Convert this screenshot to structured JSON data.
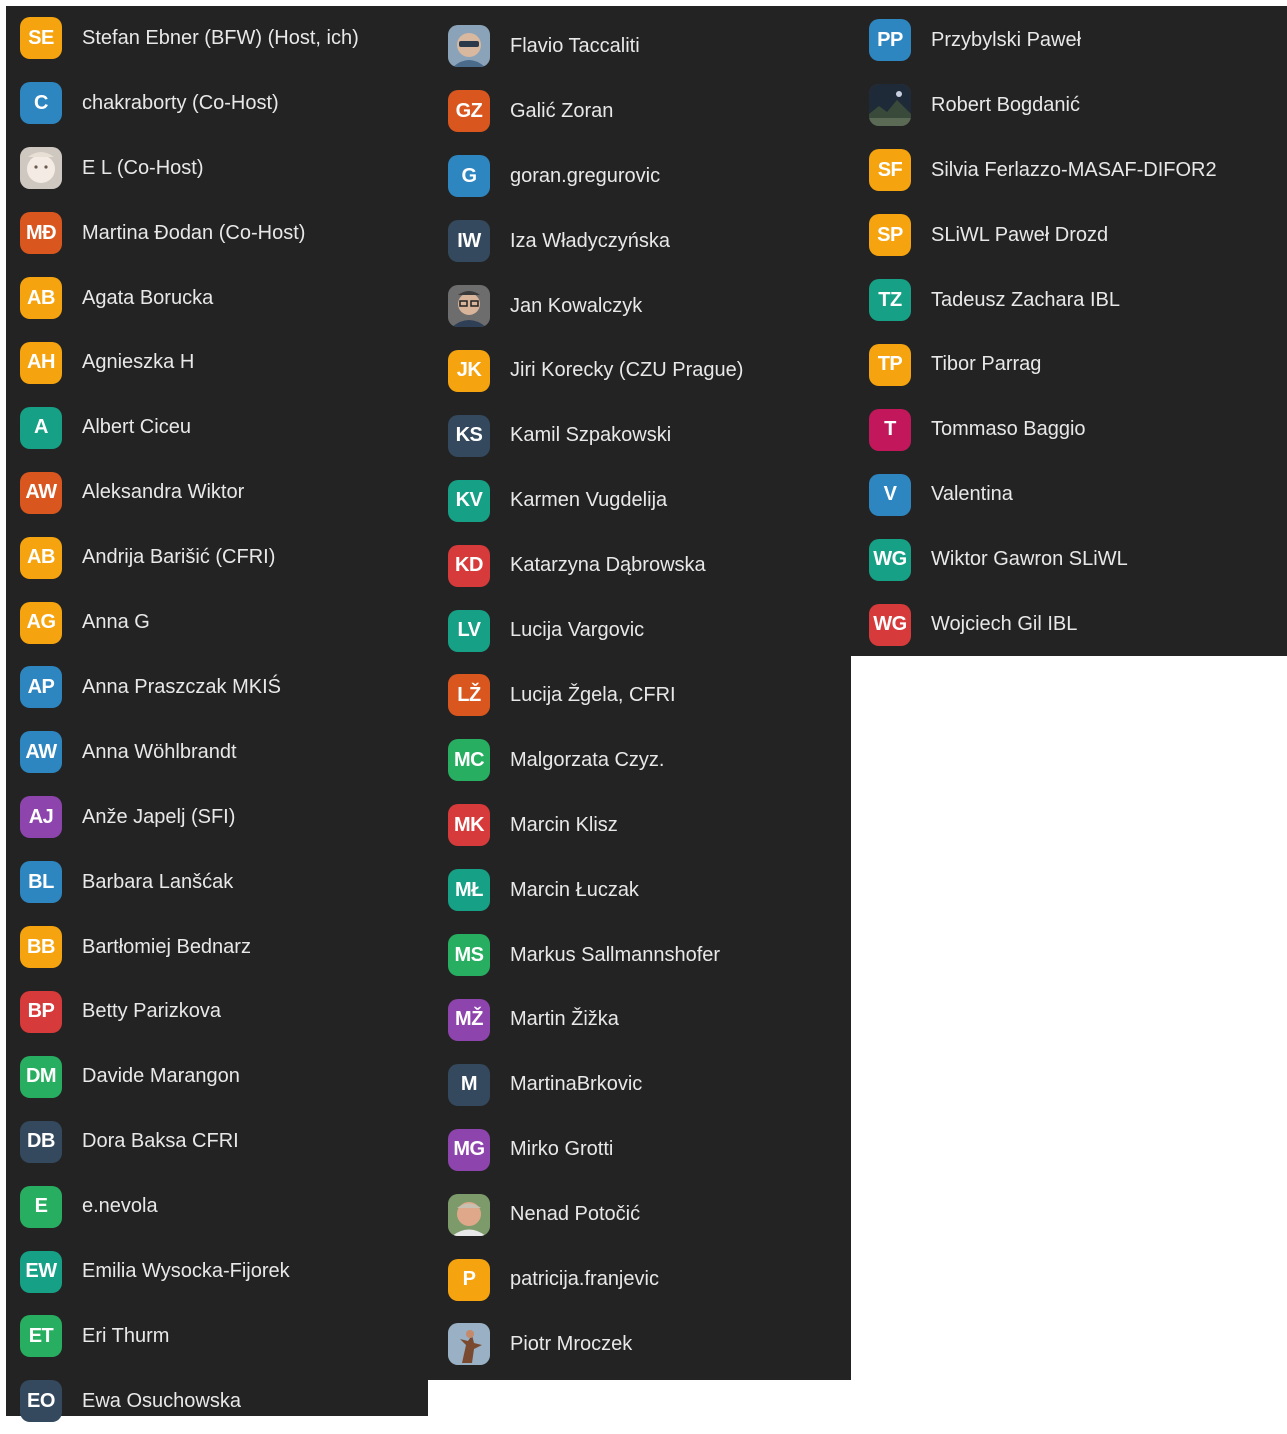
{
  "columns": [
    {
      "participants": [
        {
          "initials": "SE",
          "name": "Stefan Ebner (BFW) (Host, ich)",
          "color": "#F5A30F"
        },
        {
          "initials": "C",
          "name": "chakraborty (Co-Host)",
          "color": "#2E86C1"
        },
        {
          "initials": "",
          "name": "E L (Co-Host)",
          "color": "",
          "photo": "baby-photo"
        },
        {
          "initials": "MĐ",
          "name": "Martina Đodan (Co-Host)",
          "color": "#D9561E"
        },
        {
          "initials": "AB",
          "name": "Agata Borucka",
          "color": "#F5A30F"
        },
        {
          "initials": "AH",
          "name": "Agnieszka H",
          "color": "#F5A30F"
        },
        {
          "initials": "A",
          "name": "Albert Ciceu",
          "color": "#16A085"
        },
        {
          "initials": "AW",
          "name": "Aleksandra Wiktor",
          "color": "#D9561E"
        },
        {
          "initials": "AB",
          "name": "Andrija Barišić (CFRI)",
          "color": "#F5A30F"
        },
        {
          "initials": "AG",
          "name": "Anna G",
          "color": "#F5A30F"
        },
        {
          "initials": "AP",
          "name": "Anna Praszczak MKIŚ",
          "color": "#2E86C1"
        },
        {
          "initials": "AW",
          "name": "Anna Wöhlbrandt",
          "color": "#2E86C1"
        },
        {
          "initials": "AJ",
          "name": "Anže Japelj (SFI)",
          "color": "#8E44AD"
        },
        {
          "initials": "BL",
          "name": "Barbara Lanšćak",
          "color": "#2E86C1"
        },
        {
          "initials": "BB",
          "name": "Bartłomiej Bednarz",
          "color": "#F5A30F"
        },
        {
          "initials": "BP",
          "name": "Betty Parizkova",
          "color": "#D63A3A"
        },
        {
          "initials": "DM",
          "name": "Davide Marangon",
          "color": "#27AE60"
        },
        {
          "initials": "DB",
          "name": "Dora Baksa CFRI",
          "color": "#34495E"
        },
        {
          "initials": "E",
          "name": "e.nevola",
          "color": "#27AE60"
        },
        {
          "initials": "EW",
          "name": "Emilia Wysocka-Fijorek",
          "color": "#16A085"
        },
        {
          "initials": "ET",
          "name": "Eri Thurm",
          "color": "#27AE60"
        },
        {
          "initials": "EO",
          "name": "Ewa Osuchowska",
          "color": "#34495E"
        }
      ]
    },
    {
      "participants": [
        {
          "initials": "",
          "name": "Flavio Taccaliti",
          "color": "",
          "photo": "man-sunglasses-photo"
        },
        {
          "initials": "GZ",
          "name": "Galić Zoran",
          "color": "#D9561E"
        },
        {
          "initials": "G",
          "name": "goran.gregurovic",
          "color": "#2E86C1"
        },
        {
          "initials": "IW",
          "name": "Iza Władyczyńska",
          "color": "#34495E"
        },
        {
          "initials": "",
          "name": "Jan Kowalczyk",
          "color": "",
          "photo": "man-glasses-photo"
        },
        {
          "initials": "JK",
          "name": "Jiri Korecky (CZU Prague)",
          "color": "#F5A30F"
        },
        {
          "initials": "KS",
          "name": "Kamil Szpakowski",
          "color": "#34495E"
        },
        {
          "initials": "KV",
          "name": "Karmen Vugdelija",
          "color": "#16A085"
        },
        {
          "initials": "KD",
          "name": "Katarzyna Dąbrowska",
          "color": "#D63A3A"
        },
        {
          "initials": "LV",
          "name": "Lucija Vargovic",
          "color": "#16A085"
        },
        {
          "initials": "LŽ",
          "name": "Lucija Žgela, CFRI",
          "color": "#D9561E"
        },
        {
          "initials": "MC",
          "name": "Malgorzata Czyz.",
          "color": "#27AE60"
        },
        {
          "initials": "MK",
          "name": "Marcin Klisz",
          "color": "#D63A3A"
        },
        {
          "initials": "MŁ",
          "name": "Marcin Łuczak",
          "color": "#16A085"
        },
        {
          "initials": "MS",
          "name": "Markus Sallmannshofer",
          "color": "#27AE60"
        },
        {
          "initials": "MŽ",
          "name": "Martin Žižka",
          "color": "#8E44AD"
        },
        {
          "initials": "M",
          "name": "MartinaBrkovic",
          "color": "#34495E"
        },
        {
          "initials": "MG",
          "name": "Mirko Grotti",
          "color": "#8E44AD"
        },
        {
          "initials": "",
          "name": "Nenad Potočić",
          "color": "",
          "photo": "man-outdoor-photo"
        },
        {
          "initials": "P",
          "name": "patricija.franjevic",
          "color": "#F5A30F"
        },
        {
          "initials": "",
          "name": "Piotr Mroczek",
          "color": "",
          "photo": "figure-photo"
        }
      ]
    },
    {
      "participants": [
        {
          "initials": "PP",
          "name": "Przybylski Paweł",
          "color": "#2E86C1"
        },
        {
          "initials": "",
          "name": "Robert Bogdanić",
          "color": "",
          "photo": "night-scene-photo"
        },
        {
          "initials": "SF",
          "name": "Silvia Ferlazzo-MASAF-DIFOR2",
          "color": "#F5A30F"
        },
        {
          "initials": "SP",
          "name": "SLiWL Paweł Drozd",
          "color": "#F5A30F"
        },
        {
          "initials": "TZ",
          "name": "Tadeusz Zachara IBL",
          "color": "#16A085"
        },
        {
          "initials": "TP",
          "name": "Tibor Parrag",
          "color": "#F5A30F"
        },
        {
          "initials": "T",
          "name": "Tommaso Baggio",
          "color": "#C2185B"
        },
        {
          "initials": "V",
          "name": "Valentina",
          "color": "#2E86C1"
        },
        {
          "initials": "WG",
          "name": "Wiktor Gawron SLiWL",
          "color": "#16A085"
        },
        {
          "initials": "WG",
          "name": "Wojciech Gil IBL",
          "color": "#D63A3A"
        }
      ]
    }
  ]
}
